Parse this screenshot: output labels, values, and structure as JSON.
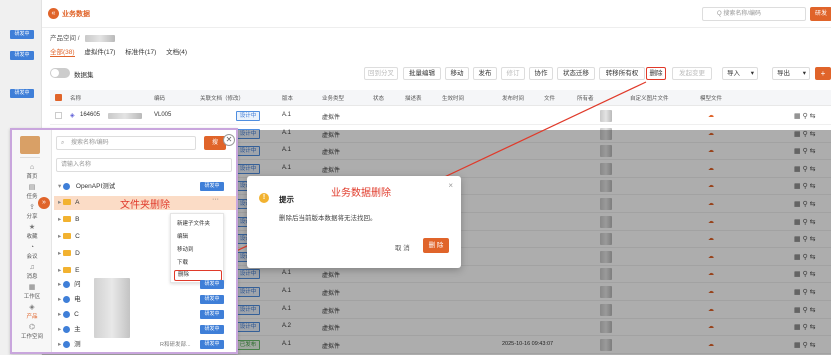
{
  "left_badges": [
    "研发中",
    "研发中",
    "研发中"
  ],
  "header": {
    "title": "业务数据",
    "search_placeholder": "Q 搜索名称/编码",
    "right_btn": "研发"
  },
  "breadcrumb": "产品空间 /",
  "tabs": [
    "全部(38)",
    "虚拟件(17)",
    "标准件(17)",
    "文档(4)"
  ],
  "toggle_label": "数据集",
  "toolbar": [
    "回到分叉",
    "批量编辑",
    "移动",
    "发布",
    "修订",
    "协作",
    "状态迁移",
    "转移所有权",
    "删除",
    "发起变更",
    "导入",
    "导出"
  ],
  "columns": [
    "名称",
    "编码",
    "关联文档（修改）",
    "版本",
    "业务类型",
    "状态",
    "描述表",
    "生效时间",
    "发布时间",
    "文件",
    "所有者",
    "自定义图片文件",
    "模型文件"
  ],
  "rows": [
    {
      "name": "164605",
      "code": "VL005",
      "version": "A.1",
      "type": "虚拟件",
      "status": "设计中"
    },
    {
      "name": "",
      "code": "",
      "version": "A.1",
      "type": "虚拟件",
      "status": "设计中"
    },
    {
      "name": "",
      "code": "",
      "version": "A.1",
      "type": "虚拟件",
      "status": "设计中"
    },
    {
      "name": "",
      "code": "",
      "version": "A.1",
      "type": "虚拟件",
      "status": "设计中"
    },
    {
      "name": "",
      "code": "",
      "version": "A.1",
      "type": "虚拟件",
      "status": "设计中"
    },
    {
      "name": "",
      "code": "",
      "version": "A.1",
      "type": "虚拟件",
      "status": "设计中"
    },
    {
      "name": "",
      "code": "",
      "version": "A.1",
      "type": "虚拟件",
      "status": "设计中"
    },
    {
      "name": "",
      "code": "",
      "version": "A.1",
      "type": "虚拟件",
      "status": "设计中"
    },
    {
      "name": "",
      "code": "",
      "version": "A.1",
      "type": "虚拟件",
      "status": "设计中"
    },
    {
      "name": "",
      "code": "",
      "version": "A.1",
      "type": "虚拟件",
      "status": "设计中"
    },
    {
      "name": "",
      "code": "",
      "version": "A.1",
      "type": "虚拟件",
      "status": "设计中"
    },
    {
      "name": "",
      "code": "",
      "version": "A.1",
      "type": "虚拟件",
      "status": "设计中"
    },
    {
      "name": "",
      "code": "",
      "version": "A.2",
      "type": "虚拟件",
      "status": "设计中"
    },
    {
      "name": "",
      "code": "",
      "version": "A.1",
      "type": "虚拟件",
      "status": "已发布",
      "date": "2025-10-16 09:43:07"
    }
  ],
  "panel": {
    "search_placeholder": "搜索名称/编码",
    "search_btn": "搜",
    "name_placeholder": "请输入名称",
    "root": "OpenAPI测试",
    "root_badge": "研发中",
    "folder_delete_label": "文件夹删除",
    "folders": [
      "A",
      "B",
      "C",
      "D",
      "E"
    ],
    "bottom_items": [
      {
        "label": "问",
        "badge": "研发中"
      },
      {
        "label": "电",
        "badge": "研发中"
      },
      {
        "label": "C",
        "badge": "研发中"
      },
      {
        "label": "主",
        "badge": "研发中"
      },
      {
        "label": "测",
        "badge": "研发中"
      }
    ],
    "bottom_suffix": "R和研发部...",
    "nav": [
      {
        "icon": "⌂",
        "label": "首页"
      },
      {
        "icon": "▤",
        "label": "任务"
      },
      {
        "icon": "⇪",
        "label": "分享"
      },
      {
        "icon": "★",
        "label": "收藏"
      },
      {
        "icon": "◔",
        "label": "会议"
      },
      {
        "icon": "♫",
        "label": "消息"
      },
      {
        "icon": "▦",
        "label": "工作区"
      },
      {
        "icon": "◈",
        "label": "产品"
      },
      {
        "icon": "⌬",
        "label": "工作空间"
      }
    ],
    "context_menu": [
      "新建子文件夹",
      "编辑",
      "移动到",
      "下载",
      "删除"
    ],
    "more": "···"
  },
  "dialog": {
    "header_label": "业务数据删除",
    "title": "提示",
    "message": "删除后当前版本数据将无法找回。",
    "cancel": "取 消",
    "confirm": "删 除"
  },
  "colors": {
    "accent": "#e0642a",
    "blue": "#3f7fd8",
    "red": "#e03a2a"
  }
}
